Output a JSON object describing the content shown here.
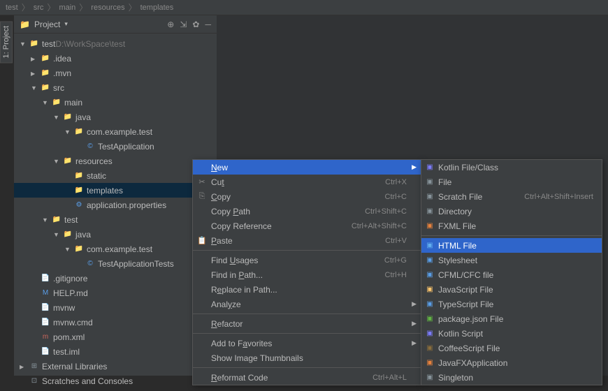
{
  "breadcrumb": [
    "test",
    "src",
    "main",
    "resources",
    "templates"
  ],
  "side_tab": "1: Project",
  "panel": {
    "title": "Project",
    "icons": [
      "target-icon",
      "expand-icon",
      "gear-icon",
      "collapse-icon"
    ]
  },
  "tree": [
    {
      "depth": 0,
      "arrow": "expanded",
      "icon": "module",
      "label": "test",
      "suffix": "D:\\WorkSpace\\test",
      "sel": false
    },
    {
      "depth": 1,
      "arrow": "collapsed",
      "icon": "folder",
      "label": ".idea",
      "sel": false
    },
    {
      "depth": 1,
      "arrow": "collapsed",
      "icon": "folder",
      "label": ".mvn",
      "sel": false
    },
    {
      "depth": 1,
      "arrow": "expanded",
      "icon": "folder",
      "label": "src",
      "sel": false
    },
    {
      "depth": 2,
      "arrow": "expanded",
      "icon": "folder",
      "label": "main",
      "sel": false
    },
    {
      "depth": 3,
      "arrow": "expanded",
      "icon": "folder-src",
      "label": "java",
      "sel": false
    },
    {
      "depth": 4,
      "arrow": "expanded",
      "icon": "package",
      "label": "com.example.test",
      "sel": false
    },
    {
      "depth": 5,
      "arrow": "none",
      "icon": "class",
      "label": "TestApplication",
      "sel": false
    },
    {
      "depth": 3,
      "arrow": "expanded",
      "icon": "folder-res",
      "label": "resources",
      "sel": false
    },
    {
      "depth": 4,
      "arrow": "none",
      "icon": "folder",
      "label": "static",
      "sel": false
    },
    {
      "depth": 4,
      "arrow": "none",
      "icon": "folder",
      "label": "templates",
      "sel": true
    },
    {
      "depth": 4,
      "arrow": "none",
      "icon": "props",
      "label": "application.properties",
      "sel": false
    },
    {
      "depth": 2,
      "arrow": "expanded",
      "icon": "folder",
      "label": "test",
      "sel": false
    },
    {
      "depth": 3,
      "arrow": "expanded",
      "icon": "folder-test",
      "label": "java",
      "sel": false
    },
    {
      "depth": 4,
      "arrow": "expanded",
      "icon": "package",
      "label": "com.example.test",
      "sel": false
    },
    {
      "depth": 5,
      "arrow": "none",
      "icon": "class",
      "label": "TestApplicationTests",
      "sel": false
    },
    {
      "depth": 1,
      "arrow": "none",
      "icon": "file",
      "label": ".gitignore",
      "sel": false
    },
    {
      "depth": 1,
      "arrow": "none",
      "icon": "md",
      "label": "HELP.md",
      "sel": false
    },
    {
      "depth": 1,
      "arrow": "none",
      "icon": "file",
      "label": "mvnw",
      "sel": false
    },
    {
      "depth": 1,
      "arrow": "none",
      "icon": "file",
      "label": "mvnw.cmd",
      "sel": false
    },
    {
      "depth": 1,
      "arrow": "none",
      "icon": "maven",
      "label": "pom.xml",
      "sel": false
    },
    {
      "depth": 1,
      "arrow": "none",
      "icon": "file",
      "label": "test.iml",
      "sel": false
    },
    {
      "depth": 0,
      "arrow": "collapsed",
      "icon": "lib",
      "label": "External Libraries",
      "sel": false
    },
    {
      "depth": 0,
      "arrow": "none",
      "icon": "scratch",
      "label": "Scratches and Consoles",
      "sel": false
    }
  ],
  "context_menu": [
    {
      "type": "item",
      "label": "New",
      "shortcut": "",
      "arrow": true,
      "sel": true,
      "u": 0
    },
    {
      "type": "item",
      "icon": "cut",
      "label": "Cut",
      "shortcut": "Ctrl+X",
      "u": 2
    },
    {
      "type": "item",
      "icon": "copy",
      "label": "Copy",
      "shortcut": "Ctrl+C",
      "u": 0
    },
    {
      "type": "item",
      "label": "Copy Path",
      "shortcut": "Ctrl+Shift+C",
      "u": 5
    },
    {
      "type": "item",
      "label": "Copy Reference",
      "shortcut": "Ctrl+Alt+Shift+C"
    },
    {
      "type": "item",
      "icon": "paste",
      "label": "Paste",
      "shortcut": "Ctrl+V",
      "u": 0
    },
    {
      "type": "sep"
    },
    {
      "type": "item",
      "label": "Find Usages",
      "shortcut": "Ctrl+G",
      "u": 5
    },
    {
      "type": "item",
      "label": "Find in Path...",
      "shortcut": "Ctrl+H",
      "u": 8
    },
    {
      "type": "item",
      "label": "Replace in Path...",
      "u": 1
    },
    {
      "type": "item",
      "label": "Analyze",
      "arrow": true,
      "u": 4
    },
    {
      "type": "sep"
    },
    {
      "type": "item",
      "label": "Refactor",
      "arrow": true,
      "u": 0
    },
    {
      "type": "sep"
    },
    {
      "type": "item",
      "label": "Add to Favorites",
      "arrow": true,
      "u": 8
    },
    {
      "type": "item",
      "label": "Show Image Thumbnails"
    },
    {
      "type": "sep"
    },
    {
      "type": "item",
      "label": "Reformat Code",
      "shortcut": "Ctrl+Alt+L",
      "u": 0
    }
  ],
  "submenu": [
    {
      "icon": "kt",
      "label": "Kotlin File/Class",
      "color": "#7c7cff"
    },
    {
      "icon": "file",
      "label": "File",
      "color": "#87939a"
    },
    {
      "icon": "scratch",
      "label": "Scratch File",
      "shortcut": "Ctrl+Alt+Shift+Insert",
      "color": "#87939a"
    },
    {
      "icon": "dir",
      "label": "Directory",
      "color": "#87939a"
    },
    {
      "icon": "fxml",
      "label": "FXML File",
      "color": "#e8823d"
    },
    {
      "type": "sep"
    },
    {
      "icon": "html",
      "label": "HTML File",
      "sel": true,
      "color": "#61afef"
    },
    {
      "icon": "css",
      "label": "Stylesheet",
      "color": "#5a9ee8"
    },
    {
      "icon": "cfml",
      "label": "CFML/CFC file",
      "color": "#5a9ee8"
    },
    {
      "icon": "js",
      "label": "JavaScript File",
      "color": "#ffc66d"
    },
    {
      "icon": "ts",
      "label": "TypeScript File",
      "color": "#5a9ee8"
    },
    {
      "icon": "pkg",
      "label": "package.json File",
      "color": "#62b543"
    },
    {
      "icon": "kts",
      "label": "Kotlin Script",
      "color": "#7c7cff"
    },
    {
      "icon": "coffee",
      "label": "CoffeeScript File",
      "color": "#8a6d3b"
    },
    {
      "icon": "jfx",
      "label": "JavaFXApplication",
      "color": "#e8823d"
    },
    {
      "icon": "single",
      "label": "Singleton",
      "color": "#87939a"
    }
  ]
}
